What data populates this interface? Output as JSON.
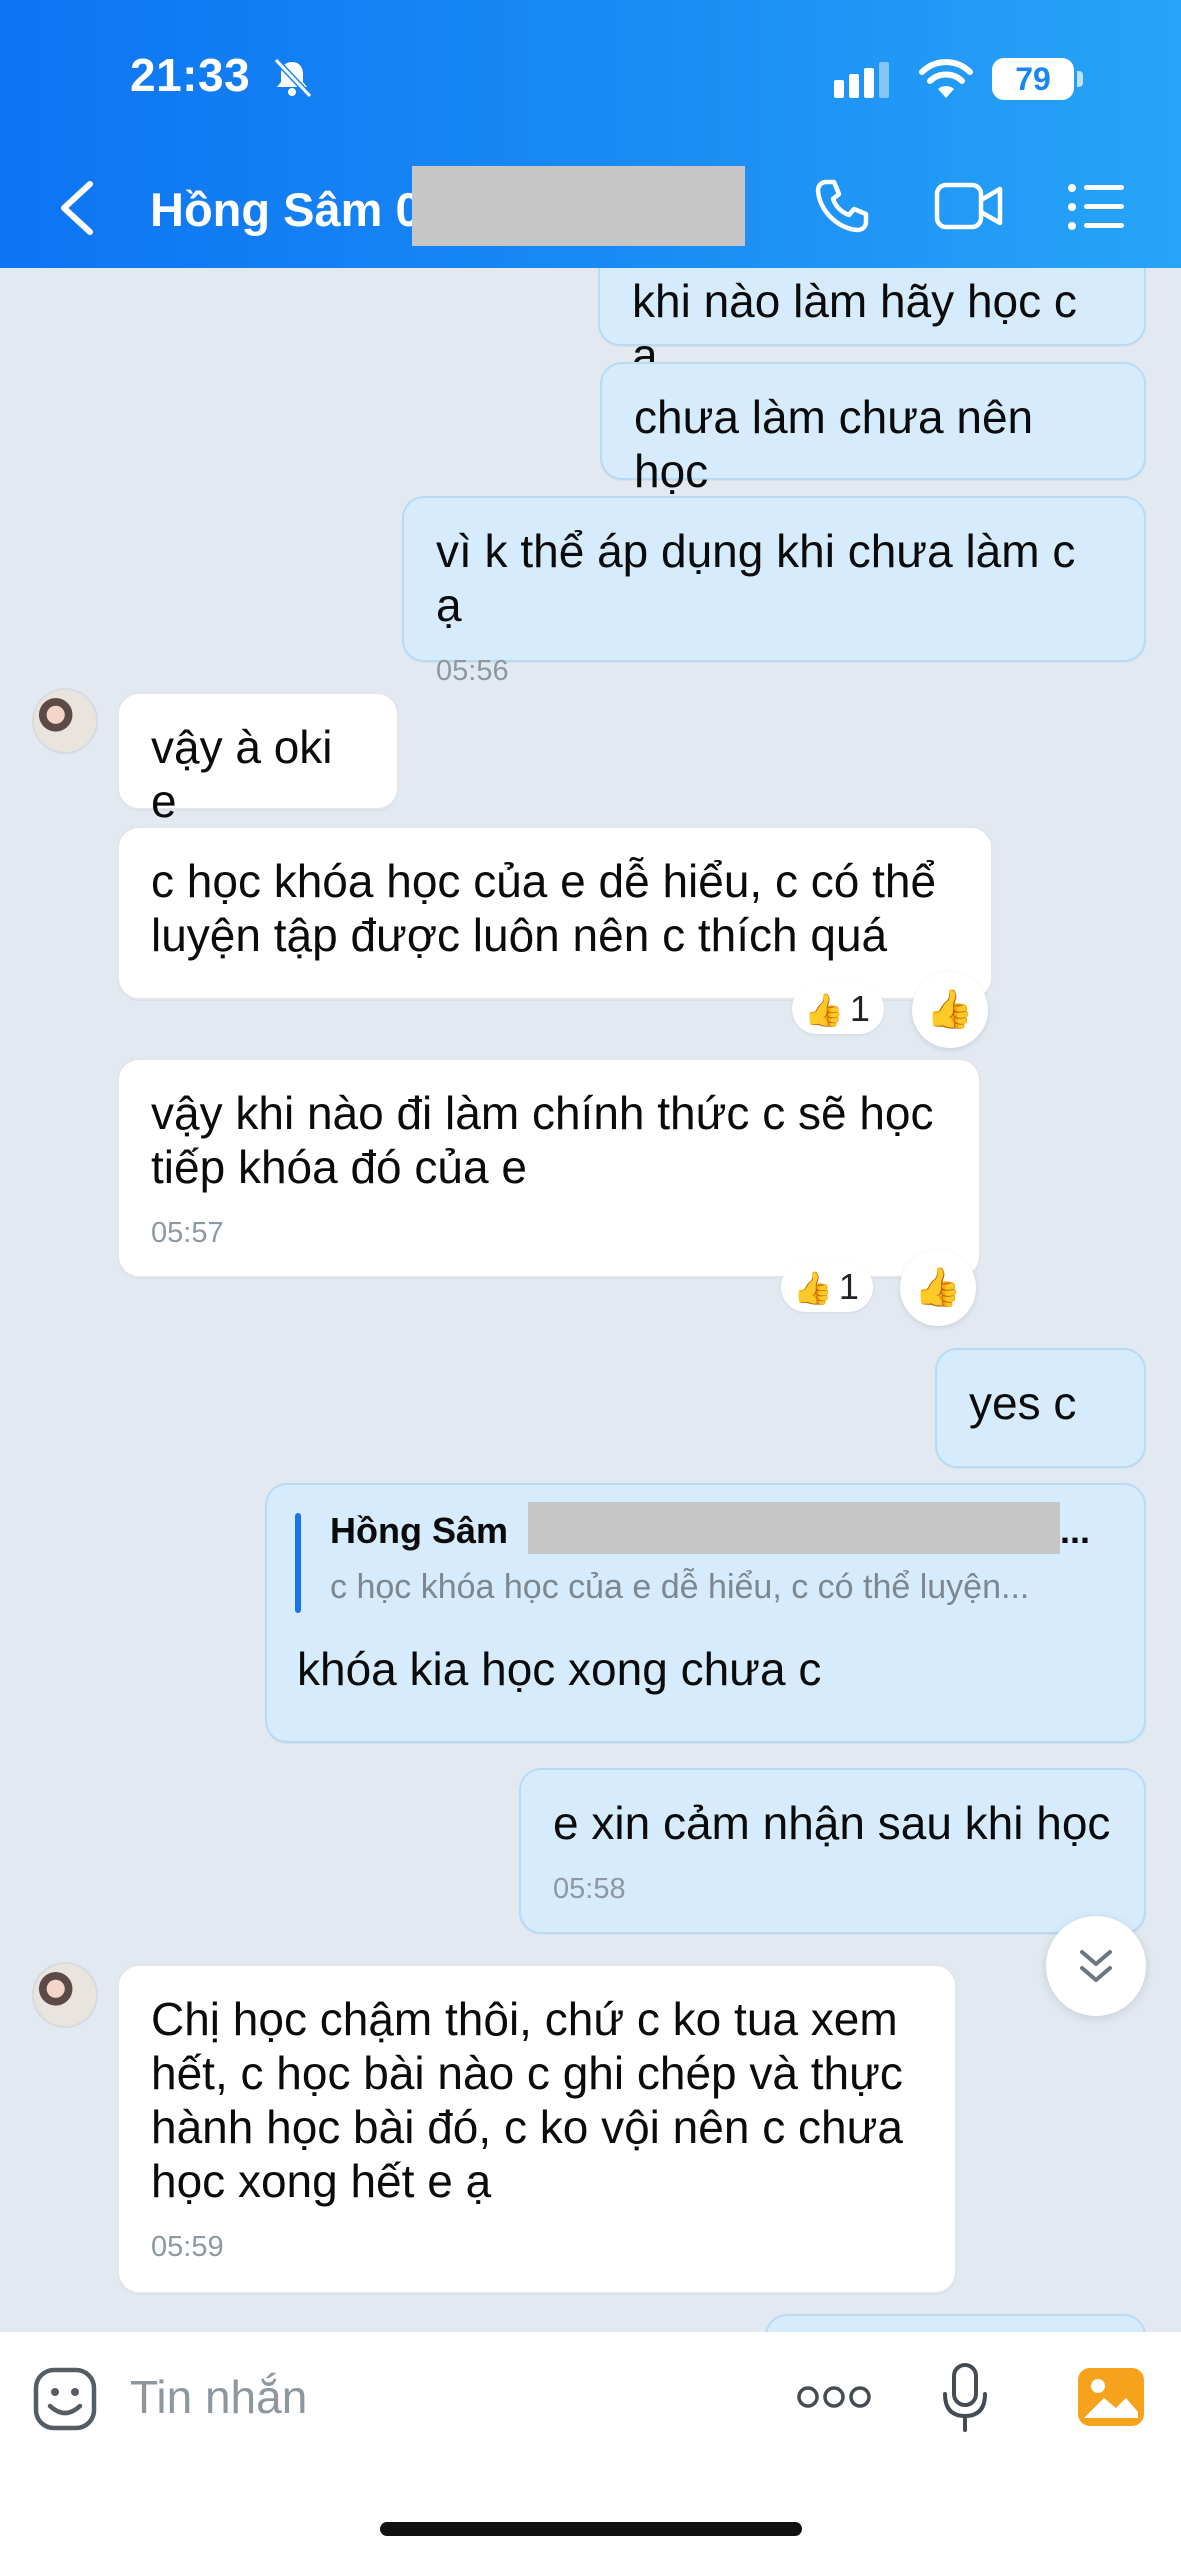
{
  "status_bar": {
    "time": "21:33",
    "battery": "79"
  },
  "header": {
    "title": "Hồng Sâm 0"
  },
  "messages": [
    {
      "text": "khi nào làm hãy học c ạ"
    },
    {
      "text": "chưa làm chưa nên học"
    },
    {
      "text": "vì k thể áp dụng khi chưa làm c ạ",
      "time": "05:56"
    },
    {
      "text": "vậy à oki e"
    },
    {
      "text": "c học khóa học của e dễ hiểu, c có thể\nluyện tập được luôn nên c thích quá",
      "reaction_count": "1"
    },
    {
      "text": "vậy khi nào đi làm chính thức c sẽ học\ntiếp khóa đó của e",
      "time": "05:57",
      "reaction_count": "1"
    },
    {
      "text": "yes c"
    },
    {
      "quote_name": "Hồng Sâm",
      "quote_name_tail": "...",
      "quote_text": "c học khóa học của e dễ hiểu, c có thể luyện...",
      "text": "khóa kia học xong chưa c"
    },
    {
      "text": "e xin cảm nhận sau khi học",
      "time": "05:58"
    },
    {
      "text": "Chị học chậm thôi, chứ c ko tua xem\nhết, c học bài nào c ghi chép và thực\nhành học bài đó, c ko vội nên c chưa\nhọc xong hết e ạ",
      "time": "05:59"
    }
  ],
  "composer": {
    "placeholder": "Tin nhắn"
  },
  "icons": {
    "back": "chevron-left-icon",
    "call": "phone-icon",
    "video": "video-camera-icon",
    "menu": "list-menu-icon",
    "sticker": "sticker-smiley-icon",
    "more": "ellipsis-icon",
    "mic": "microphone-icon",
    "image": "image-gallery-icon",
    "scroll": "double-chevron-down-icon",
    "reaction": "thumbs-up-icon"
  },
  "colors": {
    "header_start": "#0d74f2",
    "header_end": "#27a4f7",
    "outgoing_bubble": "#d6ecfc",
    "incoming_bubble": "#ffffff",
    "background": "#e2e9f1",
    "accent": "#1676e8",
    "image_button": "#f6a21a"
  }
}
